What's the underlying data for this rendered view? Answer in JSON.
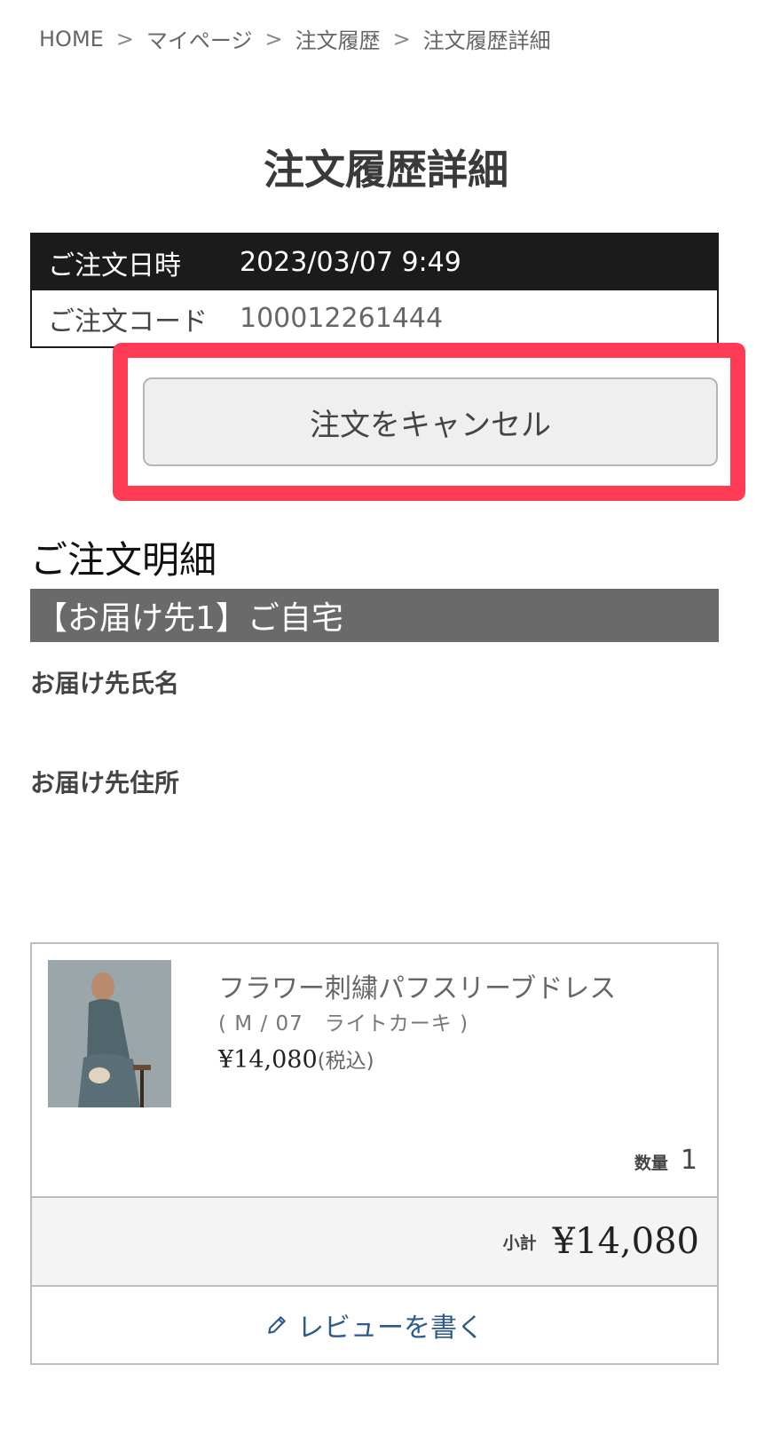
{
  "breadcrumb": {
    "items": [
      "HOME",
      "マイページ",
      "注文履歴",
      "注文履歴詳細"
    ],
    "separator": ">"
  },
  "page_title": "注文履歴詳細",
  "order_info": {
    "date_label": "ご注文日時",
    "date_value": "2023/03/07 9:49",
    "code_label": "ご注文コード",
    "code_value": "100012261444"
  },
  "cancel_button_label": "注文をキャンセル",
  "highlight_color": "#ff3b55",
  "details": {
    "section_title": "ご注文明細",
    "destination_header": "【お届け先1】ご自宅",
    "name_label": "お届け先氏名",
    "address_label": "お届け先住所"
  },
  "product": {
    "name": "フラワー刺繍パフスリーブドレス",
    "variant": "( M / 07　ライトカーキ )",
    "price": "¥14,080",
    "tax_note": "(税込)",
    "quantity_label": "数量",
    "quantity": "1",
    "subtotal_label": "小計",
    "subtotal": "¥14,080",
    "review_label": "レビューを書く",
    "review_icon": "pencil-icon"
  }
}
